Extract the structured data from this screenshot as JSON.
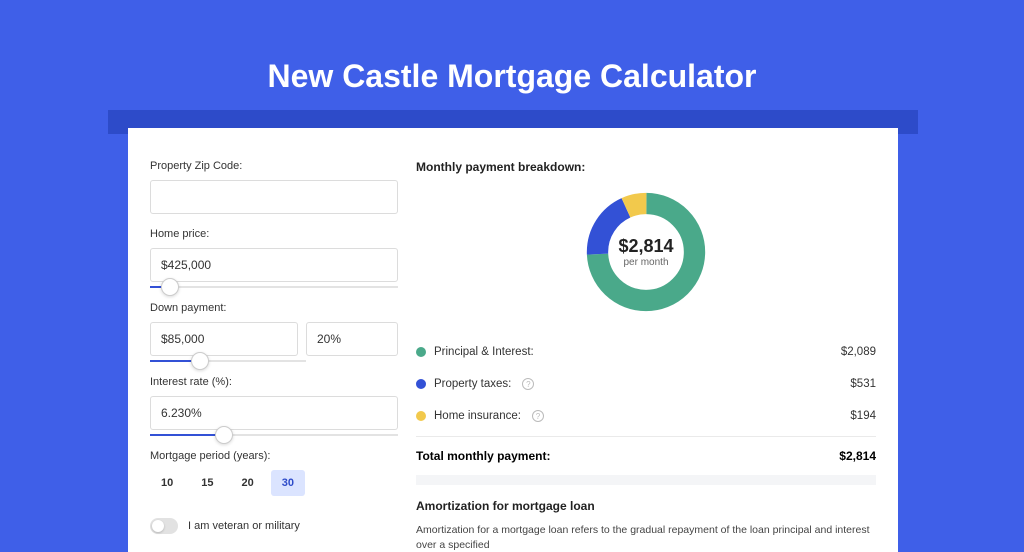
{
  "title": "New Castle Mortgage Calculator",
  "colors": {
    "principal": "#4aa98a",
    "taxes": "#3351d6",
    "insurance": "#f2c94c"
  },
  "form": {
    "zip": {
      "label": "Property Zip Code:",
      "value": ""
    },
    "home_price": {
      "label": "Home price:",
      "value": "$425,000",
      "slider_pct": 8
    },
    "down_payment": {
      "label": "Down payment:",
      "amount": "$85,000",
      "percent": "20%",
      "slider_pct": 20
    },
    "interest_rate": {
      "label": "Interest rate (%):",
      "value": "6.230%",
      "slider_pct": 30
    },
    "period": {
      "label": "Mortgage period (years):",
      "options": [
        "10",
        "15",
        "20",
        "30"
      ],
      "selected": "30"
    },
    "veteran": {
      "label": "I am veteran or military",
      "on": false
    }
  },
  "breakdown": {
    "title": "Monthly payment breakdown:",
    "center_amount": "$2,814",
    "center_sub": "per month",
    "items": [
      {
        "label": "Principal & Interest:",
        "value": "$2,089",
        "color_key": "principal",
        "info": false
      },
      {
        "label": "Property taxes:",
        "value": "$531",
        "color_key": "taxes",
        "info": true
      },
      {
        "label": "Home insurance:",
        "value": "$194",
        "color_key": "insurance",
        "info": true
      }
    ],
    "total_label": "Total monthly payment:",
    "total_value": "$2,814"
  },
  "chart_data": {
    "type": "pie",
    "title": "Monthly payment breakdown",
    "series": [
      {
        "name": "Principal & Interest",
        "value": 2089
      },
      {
        "name": "Property taxes",
        "value": 531
      },
      {
        "name": "Home insurance",
        "value": 194
      }
    ],
    "total": 2814
  },
  "amortization": {
    "title": "Amortization for mortgage loan",
    "body": "Amortization for a mortgage loan refers to the gradual repayment of the loan principal and interest over a specified"
  }
}
